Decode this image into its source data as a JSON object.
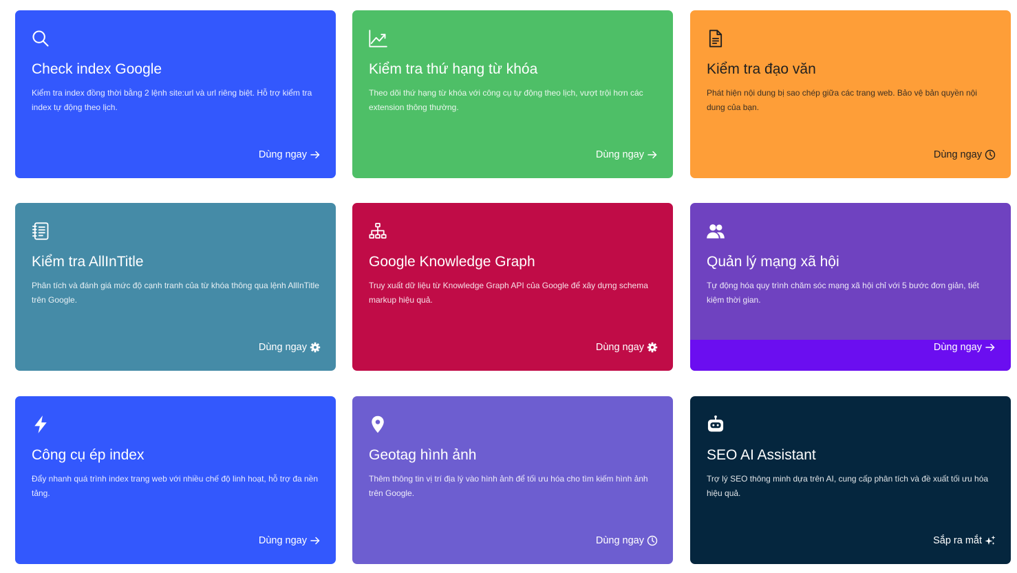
{
  "cards": [
    {
      "title": "Check index Google",
      "description": "Kiểm tra index đồng thời bằng 2 lệnh site:url và url riêng biệt. Hỗ trợ kiểm tra index tự động theo lịch.",
      "cta": "Dùng ngay",
      "icon": "search-icon",
      "cta_icon": "arrow-right-icon",
      "color": "#3358fd"
    },
    {
      "title": "Kiểm tra thứ hạng từ khóa",
      "description": "Theo dõi thứ hạng từ khóa với công cụ tự động theo lịch, vượt trội hơn các extension thông thường.",
      "cta": "Dùng ngay",
      "icon": "trending-up-icon",
      "cta_icon": "arrow-right-icon",
      "color": "#4ebf67"
    },
    {
      "title": "Kiểm tra đạo văn",
      "description": "Phát hiện nội dung bị sao chép giữa các trang web. Bảo vệ bản quyền nội dung của bạn.",
      "cta": "Dùng ngay",
      "icon": "document-icon",
      "cta_icon": "clock-icon",
      "color": "#fe9e38"
    },
    {
      "title": "Kiểm tra AllInTitle",
      "description": "Phân tích và đánh giá mức độ cạnh tranh của từ khóa thông qua lệnh AllInTitle trên Google.",
      "cta": "Dùng ngay",
      "icon": "notebook-icon",
      "cta_icon": "gear-icon",
      "color": "#458ba7"
    },
    {
      "title": "Google Knowledge Graph",
      "description": "Truy xuất dữ liệu từ Knowledge Graph API của Google để xây dựng schema markup hiệu quả.",
      "cta": "Dùng ngay",
      "icon": "sitemap-icon",
      "cta_icon": "gear-icon",
      "color": "#c00c47"
    },
    {
      "title": "Quản lý mạng xã hội",
      "description": "Tự động hóa quy trình chăm sóc mạng xã hội chỉ với 5 bước đơn giản, tiết kiệm thời gian.",
      "cta": "Dùng ngay",
      "icon": "people-icon",
      "cta_icon": "arrow-right-icon",
      "color": "#6f42c0"
    },
    {
      "title": "Công cụ ép index",
      "description": "Đẩy nhanh quá trình index trang web với nhiều chế độ linh hoạt, hỗ trợ đa nền tảng.",
      "cta": "Dùng ngay",
      "icon": "lightning-icon",
      "cta_icon": "arrow-right-icon",
      "color": "#3358fd"
    },
    {
      "title": "Geotag hình ảnh",
      "description": "Thêm thông tin vị trí địa lý vào hình ảnh để tối ưu hóa cho tìm kiếm hình ảnh trên Google.",
      "cta": "Dùng ngay",
      "icon": "map-pin-icon",
      "cta_icon": "clock-icon",
      "color": "#6d5ed0"
    },
    {
      "title": "SEO AI Assistant",
      "description": "Trợ lý SEO thông minh dựa trên AI, cung cấp phân tích và đề xuất tối ưu hóa hiệu quả.",
      "cta": "Sắp ra mắt",
      "icon": "robot-icon",
      "cta_icon": "sparkles-icon",
      "color": "#05263e"
    }
  ]
}
